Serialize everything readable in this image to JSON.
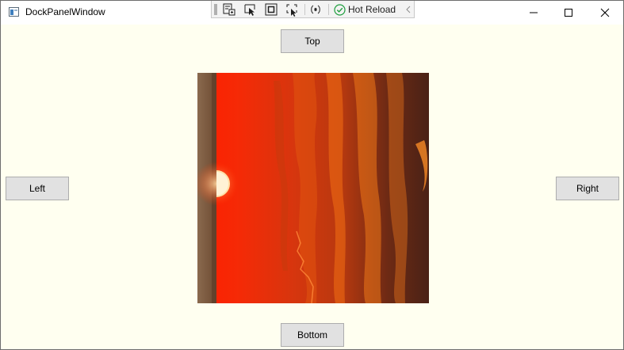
{
  "window": {
    "title": "DockPanelWindow",
    "icon": "wpf-window-icon"
  },
  "title_bar_controls": {
    "minimize_icon": "minimize-icon",
    "maximize_icon": "maximize-icon",
    "close_icon": "close-icon"
  },
  "debug_toolbar": {
    "icons": [
      "go-to-live-visual-tree-icon",
      "select-element-icon",
      "display-layout-adorners-icon",
      "track-focused-element-icon",
      "binding-failures-icon",
      "hot-reload-check-icon",
      "collapse-chevron-icon"
    ],
    "hot_reload_label": "Hot Reload",
    "hot_reload_status_color": "#1e9e3e"
  },
  "dock_panel": {
    "top_label": "Top",
    "bottom_label": "Bottom",
    "left_label": "Left",
    "right_label": "Right",
    "background_color": "#fffff0",
    "image": "sunset-image"
  }
}
